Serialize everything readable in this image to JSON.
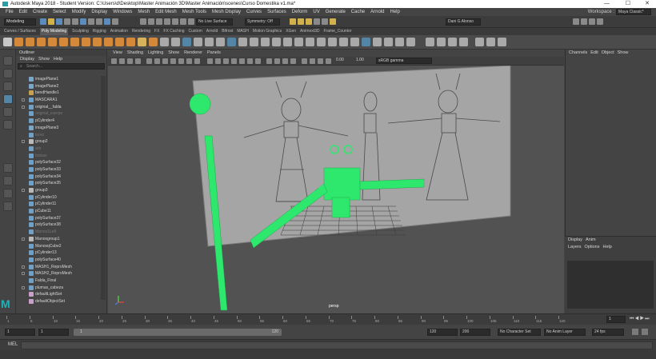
{
  "window": {
    "title": "Autodesk Maya 2018 - Student Version: C:\\Users\\d\\Desktop\\Master Animación 3D\\Master Animación\\scenes\\Curso Domestika v1.ma*",
    "controls": [
      "—",
      "☐",
      "✕"
    ]
  },
  "menubar": {
    "items": [
      "File",
      "Edit",
      "Create",
      "Select",
      "Modify",
      "Display",
      "Windows",
      "Mesh",
      "Edit Mesh",
      "Mesh Tools",
      "Mesh Display",
      "Curves",
      "Surfaces",
      "Deform",
      "UV",
      "Generate",
      "Cache",
      "Arnold",
      "Help"
    ],
    "workspace_label": "Workspace :",
    "workspace_value": "Maya Classic*"
  },
  "statusline": {
    "mode": "Modeling",
    "live_surface": "No Live Surface",
    "symmetry": "Symmetry: Off",
    "user": "Dani G Alonso"
  },
  "shelf": {
    "tabs": [
      "Curves / Surfaces",
      "Poly Modeling",
      "Sculpting",
      "Rigging",
      "Animation",
      "Rendering",
      "FX",
      "FX Caching",
      "Custom",
      "Arnold",
      "Bifrost",
      "MASH",
      "Motion Graphics",
      "XGen",
      "Animext3D",
      "Frame_Counter"
    ],
    "active_tab": "Poly Modeling"
  },
  "outliner": {
    "title": "Outliner",
    "menu": [
      "Display",
      "Show",
      "Help"
    ],
    "search_placeholder": "Search...",
    "items": [
      {
        "label": "imagePlane1",
        "icon": "image-plane",
        "dim": false,
        "expand": false
      },
      {
        "label": "imagePlane2",
        "icon": "image-plane",
        "dim": false,
        "expand": false
      },
      {
        "label": "bendHandle1",
        "icon": "deformer",
        "dim": false,
        "expand": false
      },
      {
        "label": "MASCARA1",
        "icon": "mesh",
        "dim": false,
        "expand": true
      },
      {
        "label": "original__falda",
        "icon": "mesh",
        "dim": false,
        "expand": true
      },
      {
        "label": "original_cuerpo",
        "icon": "mesh",
        "dim": true,
        "expand": false
      },
      {
        "label": "pCylinder4",
        "icon": "mesh",
        "dim": false,
        "expand": false
      },
      {
        "label": "imagePlane3",
        "icon": "image-plane",
        "dim": false,
        "expand": false
      },
      {
        "label": "torso",
        "icon": "mesh",
        "dim": true,
        "expand": false
      },
      {
        "label": "group2",
        "icon": "group",
        "dim": false,
        "expand": true
      },
      {
        "label": "arb",
        "icon": "mesh",
        "dim": true,
        "expand": false
      },
      {
        "label": "bolsas",
        "icon": "mesh",
        "dim": true,
        "expand": false
      },
      {
        "label": "polySurface32",
        "icon": "mesh",
        "dim": false,
        "expand": false
      },
      {
        "label": "polySurface33",
        "icon": "mesh",
        "dim": false,
        "expand": false
      },
      {
        "label": "polySurface34",
        "icon": "mesh",
        "dim": false,
        "expand": false
      },
      {
        "label": "polySurface35",
        "icon": "mesh",
        "dim": false,
        "expand": false
      },
      {
        "label": "group3",
        "icon": "group",
        "dim": false,
        "expand": true
      },
      {
        "label": "pCylinder10",
        "icon": "mesh",
        "dim": false,
        "expand": false
      },
      {
        "label": "pCylinder11",
        "icon": "mesh",
        "dim": false,
        "expand": false
      },
      {
        "label": "pCube11",
        "icon": "mesh",
        "dim": false,
        "expand": false
      },
      {
        "label": "polySurface37",
        "icon": "mesh",
        "dim": false,
        "expand": false
      },
      {
        "label": "polySurface38",
        "icon": "mesh",
        "dim": false,
        "expand": false
      },
      {
        "label": "Manos1Left",
        "icon": "mesh",
        "dim": true,
        "expand": false
      },
      {
        "label": "Manosgroup1",
        "icon": "group",
        "dim": false,
        "expand": true
      },
      {
        "label": "ManosqCube2",
        "icon": "mesh",
        "dim": false,
        "expand": false
      },
      {
        "label": "pCylinder13",
        "icon": "mesh",
        "dim": false,
        "expand": false
      },
      {
        "label": "polySurface40",
        "icon": "mesh",
        "dim": false,
        "expand": false
      },
      {
        "label": "MASH1_ReproMesh",
        "icon": "mesh",
        "dim": false,
        "expand": true
      },
      {
        "label": "MASH2_ReproMesh",
        "icon": "mesh",
        "dim": false,
        "expand": true
      },
      {
        "label": "Falda_Final",
        "icon": "mesh",
        "dim": false,
        "expand": false
      },
      {
        "label": "plumas_cabeza",
        "icon": "mesh",
        "dim": false,
        "expand": true
      },
      {
        "label": "defaultLightSet",
        "icon": "set",
        "dim": false,
        "expand": false
      },
      {
        "label": "defaultObjectSet",
        "icon": "set",
        "dim": false,
        "expand": false
      }
    ]
  },
  "viewport": {
    "menu": [
      "View",
      "Shading",
      "Lighting",
      "Show",
      "Renderer",
      "Panels"
    ],
    "exposure": "0.00",
    "gamma": "1.00",
    "color_space": "sRGB gamma",
    "camera_label": "persp"
  },
  "channels": {
    "tabs": [
      "Channels",
      "Edit",
      "Object",
      "Show"
    ]
  },
  "layers": {
    "tabs": [
      "Display",
      "Anim"
    ],
    "menu": [
      "Layers",
      "Options",
      "Help"
    ]
  },
  "timeline": {
    "ticks": [
      "1",
      "5",
      "10",
      "15",
      "20",
      "25",
      "30",
      "35",
      "40",
      "45",
      "50",
      "55",
      "60",
      "65",
      "70",
      "75",
      "80",
      "85",
      "90",
      "95",
      "100",
      "105",
      "110",
      "115",
      "120"
    ],
    "current_frame": "1"
  },
  "range": {
    "start": "1",
    "playback_start": "1",
    "slider_start": "1",
    "slider_end": "120",
    "playback_end": "120",
    "end": "200",
    "character_set": "No Character Set",
    "anim_layer": "No Anim Layer",
    "fps": "24 fps"
  },
  "cmdline": {
    "lang": "MEL"
  },
  "colors": {
    "selection_green": "#2ee86d",
    "maya_teal": "#22b0bb",
    "accent_blue": "#5285a6"
  }
}
